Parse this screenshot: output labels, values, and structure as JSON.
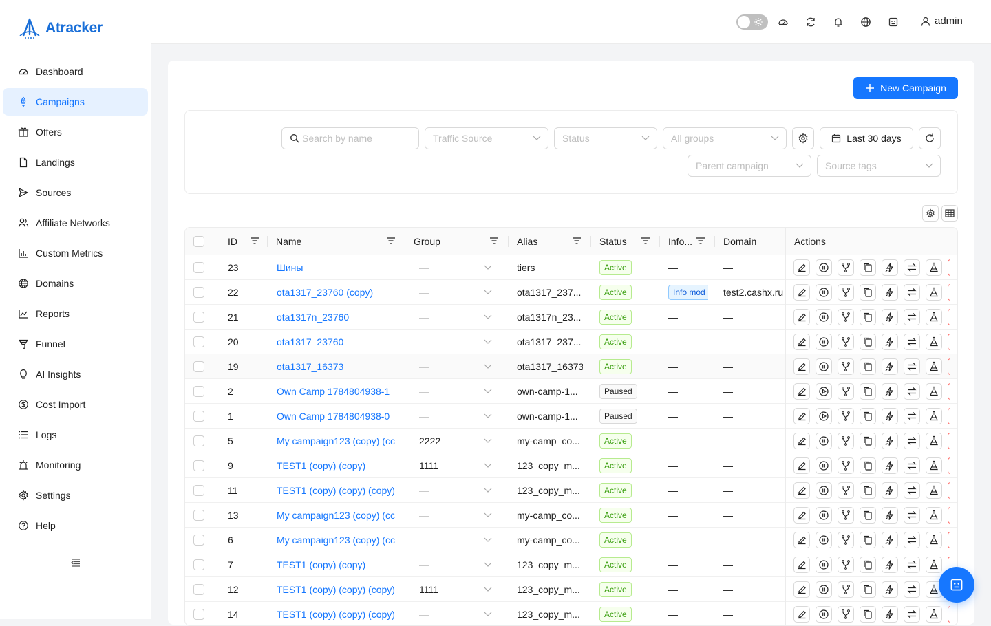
{
  "app": {
    "name": "Atracker",
    "brand_color": "#1677ff"
  },
  "sidebar": {
    "items": [
      {
        "label": "Dashboard",
        "icon": "dashboard-icon"
      },
      {
        "label": "Campaigns",
        "icon": "rocket-icon",
        "active": true
      },
      {
        "label": "Offers",
        "icon": "gift-icon"
      },
      {
        "label": "Landings",
        "icon": "file-icon"
      },
      {
        "label": "Sources",
        "icon": "send-icon"
      },
      {
        "label": "Affiliate Networks",
        "icon": "users-icon"
      },
      {
        "label": "Custom Metrics",
        "icon": "bar-chart-icon"
      },
      {
        "label": "Domains",
        "icon": "globe-icon"
      },
      {
        "label": "Reports",
        "icon": "line-chart-icon"
      },
      {
        "label": "Funnel",
        "icon": "funnel-icon"
      },
      {
        "label": "AI Insights",
        "icon": "bulb-icon"
      },
      {
        "label": "Cost Import",
        "icon": "dollar-icon"
      },
      {
        "label": "Logs",
        "icon": "list-icon"
      },
      {
        "label": "Monitoring",
        "icon": "monitor-icon"
      },
      {
        "label": "Settings",
        "icon": "gear-icon"
      },
      {
        "label": "Help",
        "icon": "question-icon"
      }
    ]
  },
  "topbar": {
    "user": "admin"
  },
  "toolbar": {
    "new_campaign": "New Campaign"
  },
  "filters": {
    "search_placeholder": "Search by name",
    "traffic_source": "Traffic Source",
    "status": "Status",
    "groups": "All groups",
    "date_range": "Last 30 days",
    "parent_campaign": "Parent campaign",
    "source_tags": "Source tags"
  },
  "table": {
    "columns": {
      "id": "ID",
      "name": "Name",
      "group": "Group",
      "alias": "Alias",
      "status": "Status",
      "info": "Info...",
      "domain": "Domain",
      "actions": "Actions"
    },
    "rows": [
      {
        "id": "23",
        "name": "Шины",
        "group": "—",
        "alias": "tiers",
        "status": "Active",
        "info": "—",
        "domain": "—",
        "toggle": "pause"
      },
      {
        "id": "22",
        "name": "ota1317_23760 (copy)",
        "group": "—",
        "alias": "ota1317_237...",
        "status": "Active",
        "info": "Info mod",
        "domain": "test2.cashx.ru",
        "toggle": "pause"
      },
      {
        "id": "21",
        "name": "ota1317n_23760",
        "group": "—",
        "alias": "ota1317n_23...",
        "status": "Active",
        "info": "—",
        "domain": "—",
        "toggle": "pause"
      },
      {
        "id": "20",
        "name": "ota1317_23760",
        "group": "—",
        "alias": "ota1317_237...",
        "status": "Active",
        "info": "—",
        "domain": "—",
        "toggle": "pause"
      },
      {
        "id": "19",
        "name": "ota1317_16373",
        "group": "—",
        "alias": "ota1317_16373",
        "status": "Active",
        "info": "—",
        "domain": "—",
        "toggle": "pause",
        "highlight": true
      },
      {
        "id": "2",
        "name": "Own Camp 1784804938-1",
        "group": "—",
        "alias": "own-camp-1...",
        "status": "Paused",
        "info": "—",
        "domain": "—",
        "toggle": "play"
      },
      {
        "id": "1",
        "name": "Own Camp 1784804938-0",
        "group": "—",
        "alias": "own-camp-1...",
        "status": "Paused",
        "info": "—",
        "domain": "—",
        "toggle": "play"
      },
      {
        "id": "5",
        "name": "My campaign123 (copy) (cc",
        "group": "2222",
        "alias": "my-camp_co...",
        "status": "Active",
        "info": "—",
        "domain": "—",
        "toggle": "pause"
      },
      {
        "id": "9",
        "name": "TEST1 (copy) (copy)",
        "group": "1111",
        "alias": "123_copy_m...",
        "status": "Active",
        "info": "—",
        "domain": "—",
        "toggle": "pause"
      },
      {
        "id": "11",
        "name": "TEST1 (copy) (copy) (copy)",
        "group": "—",
        "alias": "123_copy_m...",
        "status": "Active",
        "info": "—",
        "domain": "—",
        "toggle": "pause"
      },
      {
        "id": "13",
        "name": "My campaign123 (copy) (cc",
        "group": "—",
        "alias": "my-camp_co...",
        "status": "Active",
        "info": "—",
        "domain": "—",
        "toggle": "pause"
      },
      {
        "id": "6",
        "name": "My campaign123 (copy) (cc",
        "group": "—",
        "alias": "my-camp_co...",
        "status": "Active",
        "info": "—",
        "domain": "—",
        "toggle": "pause"
      },
      {
        "id": "7",
        "name": "TEST1 (copy) (copy)",
        "group": "—",
        "alias": "123_copy_m...",
        "status": "Active",
        "info": "—",
        "domain": "—",
        "toggle": "pause"
      },
      {
        "id": "12",
        "name": "TEST1 (copy) (copy) (copy)",
        "group": "1111",
        "alias": "123_copy_m...",
        "status": "Active",
        "info": "—",
        "domain": "—",
        "toggle": "pause"
      },
      {
        "id": "14",
        "name": "TEST1 (copy) (copy) (copy)",
        "group": "—",
        "alias": "123_copy_m...",
        "status": "Active",
        "info": "—",
        "domain": "—",
        "toggle": "pause"
      }
    ]
  }
}
